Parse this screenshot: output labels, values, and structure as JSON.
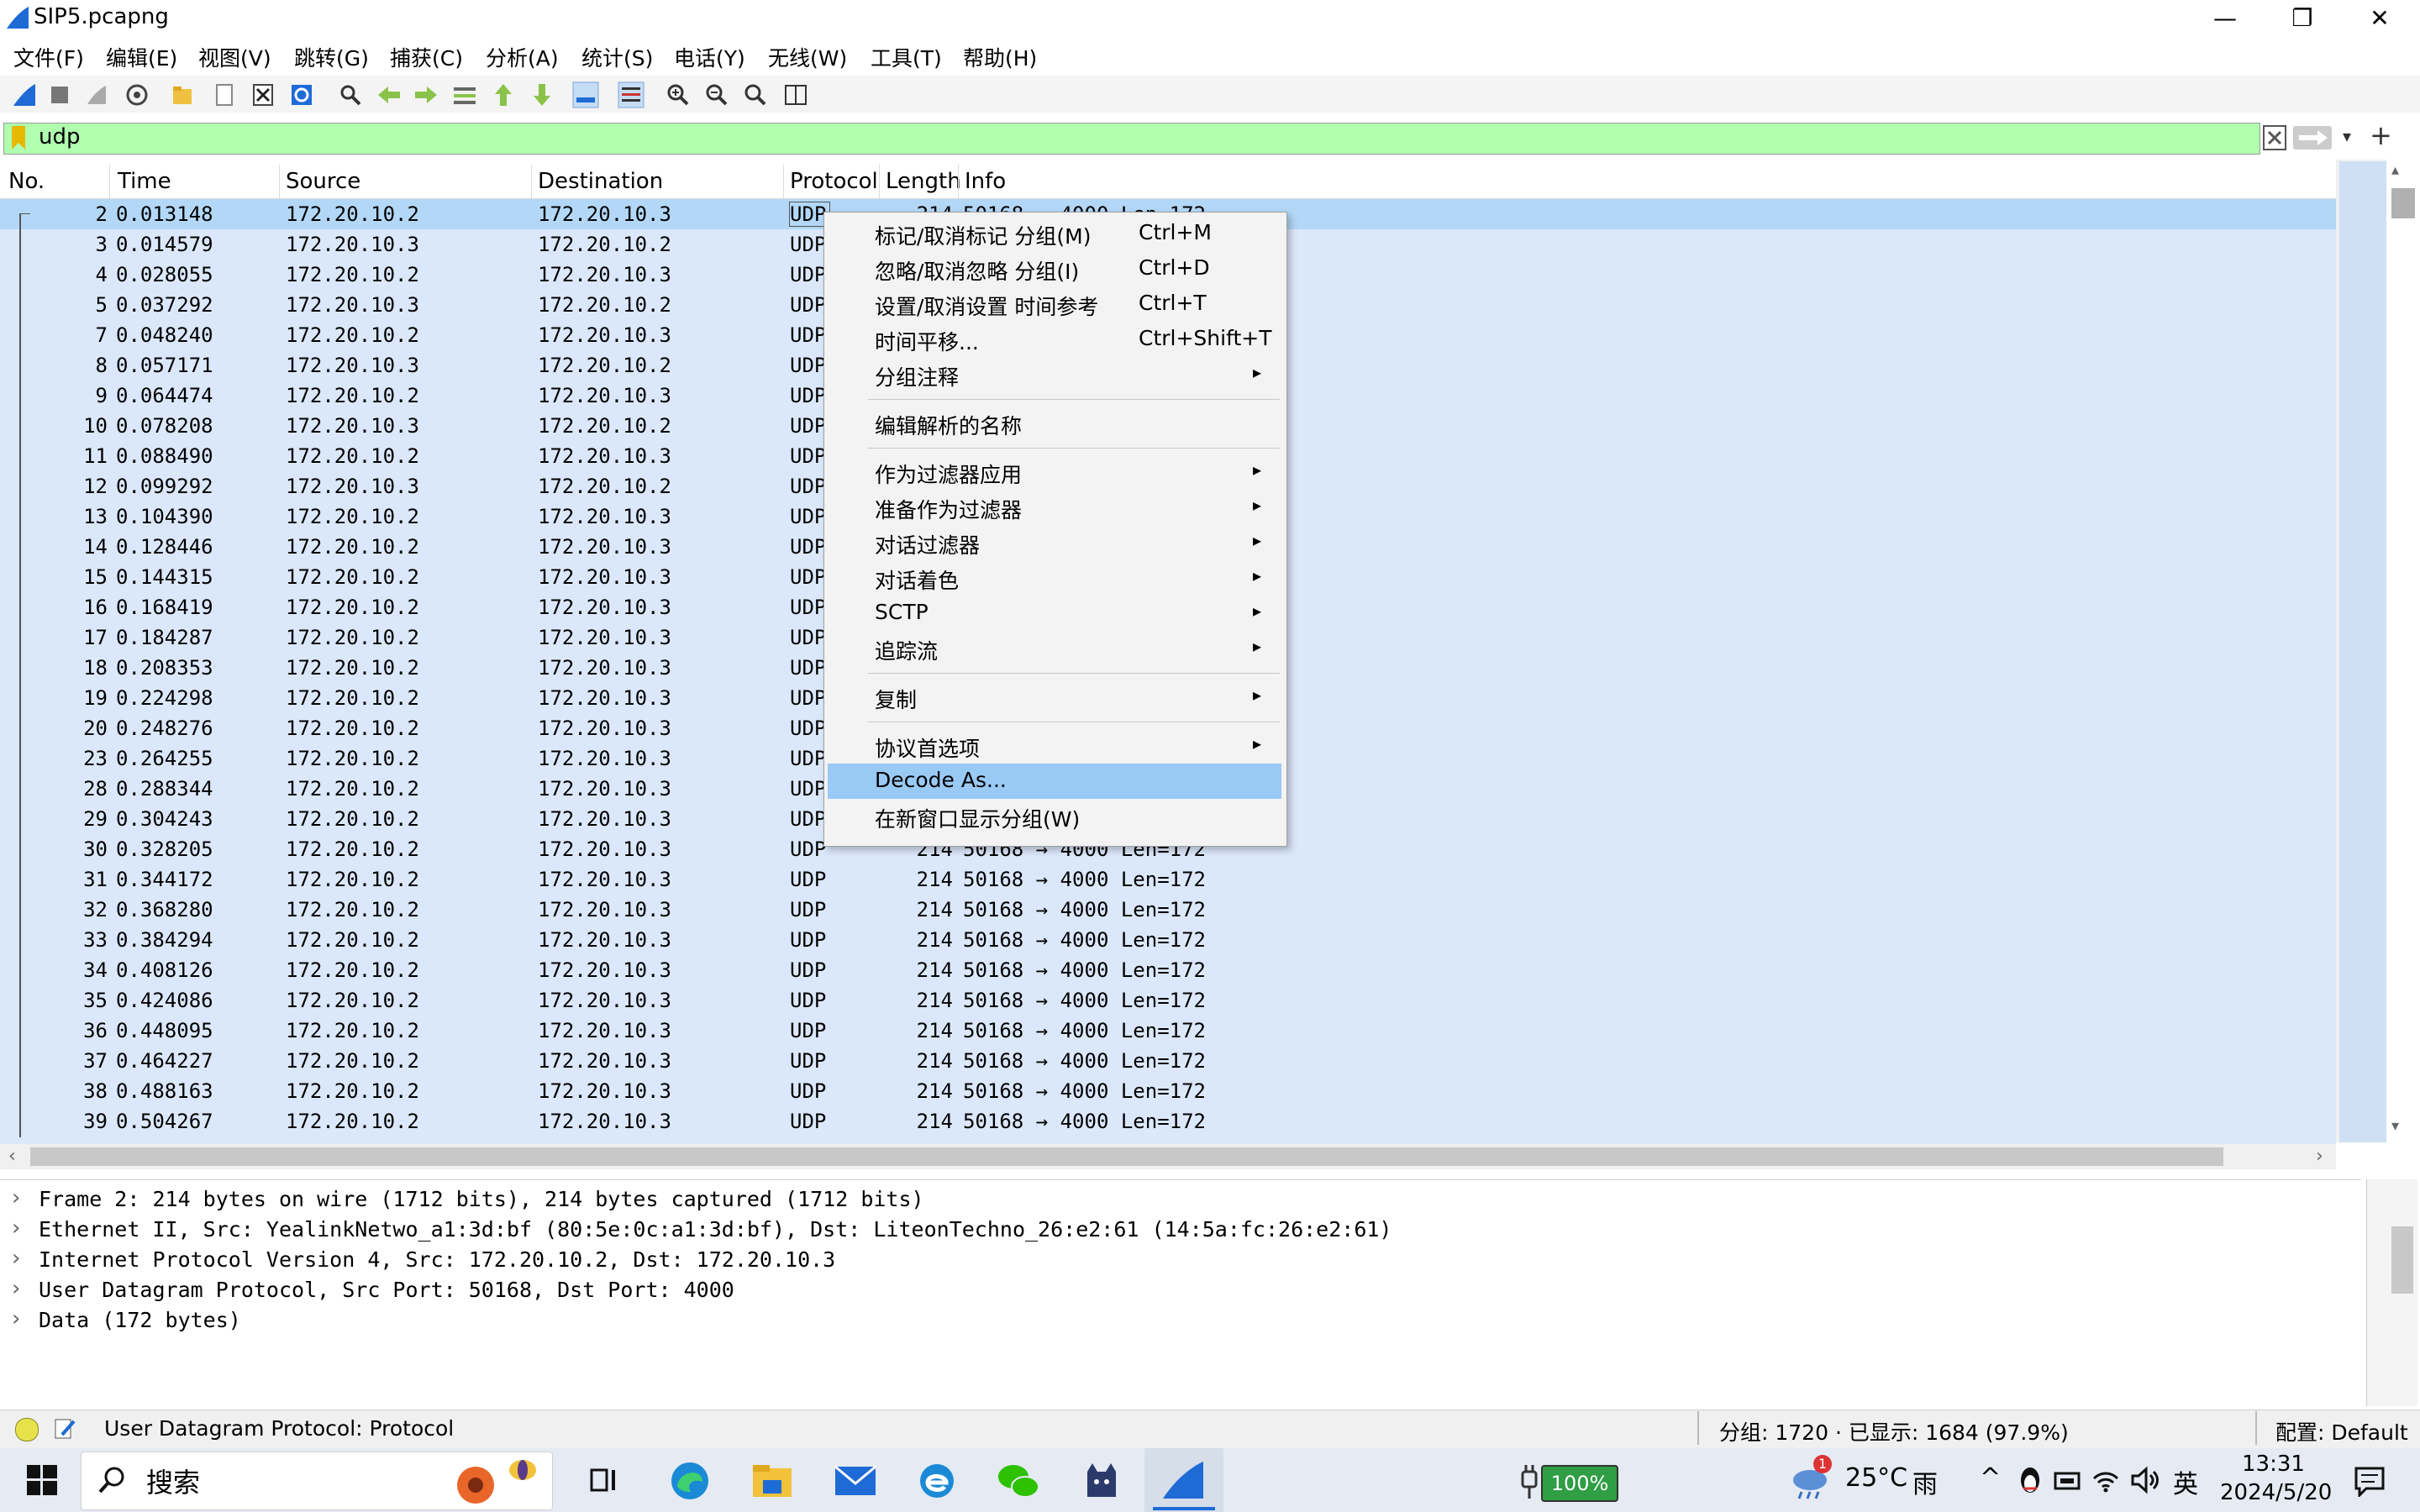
{
  "window": {
    "title": "SIP5.pcapng",
    "minimize": "—",
    "restore": "❐",
    "close": "✕"
  },
  "menubar": [
    "文件(F)",
    "编辑(E)",
    "视图(V)",
    "跳转(G)",
    "捕获(C)",
    "分析(A)",
    "统计(S)",
    "电话(Y)",
    "无线(W)",
    "工具(T)",
    "帮助(H)"
  ],
  "filter": {
    "value": "udp"
  },
  "columns": [
    "No.",
    "Time",
    "Source",
    "Destination",
    "Protocol",
    "Length",
    "Info"
  ],
  "packets": [
    {
      "no": "2",
      "time": "0.013148",
      "src": "172.20.10.2",
      "dst": "172.20.10.3",
      "proto": "UDP",
      "len": "214",
      "info": "50168 → 4000 Len=172"
    },
    {
      "no": "3",
      "time": "0.014579",
      "src": "172.20.10.3",
      "dst": "172.20.10.2",
      "proto": "UDP",
      "len": "",
      "info": ""
    },
    {
      "no": "4",
      "time": "0.028055",
      "src": "172.20.10.2",
      "dst": "172.20.10.3",
      "proto": "UDP",
      "len": "",
      "info": ""
    },
    {
      "no": "5",
      "time": "0.037292",
      "src": "172.20.10.3",
      "dst": "172.20.10.2",
      "proto": "UDP",
      "len": "",
      "info": ""
    },
    {
      "no": "7",
      "time": "0.048240",
      "src": "172.20.10.2",
      "dst": "172.20.10.3",
      "proto": "UDP",
      "len": "",
      "info": ""
    },
    {
      "no": "8",
      "time": "0.057171",
      "src": "172.20.10.3",
      "dst": "172.20.10.2",
      "proto": "UDP",
      "len": "",
      "info": ""
    },
    {
      "no": "9",
      "time": "0.064474",
      "src": "172.20.10.2",
      "dst": "172.20.10.3",
      "proto": "UDP",
      "len": "",
      "info": ""
    },
    {
      "no": "10",
      "time": "0.078208",
      "src": "172.20.10.3",
      "dst": "172.20.10.2",
      "proto": "UDP",
      "len": "",
      "info": ""
    },
    {
      "no": "11",
      "time": "0.088490",
      "src": "172.20.10.2",
      "dst": "172.20.10.3",
      "proto": "UDP",
      "len": "",
      "info": ""
    },
    {
      "no": "12",
      "time": "0.099292",
      "src": "172.20.10.3",
      "dst": "172.20.10.2",
      "proto": "UDP",
      "len": "",
      "info": ""
    },
    {
      "no": "13",
      "time": "0.104390",
      "src": "172.20.10.2",
      "dst": "172.20.10.3",
      "proto": "UDP",
      "len": "",
      "info": ""
    },
    {
      "no": "14",
      "time": "0.128446",
      "src": "172.20.10.2",
      "dst": "172.20.10.3",
      "proto": "UDP",
      "len": "",
      "info": ""
    },
    {
      "no": "15",
      "time": "0.144315",
      "src": "172.20.10.2",
      "dst": "172.20.10.3",
      "proto": "UDP",
      "len": "",
      "info": ""
    },
    {
      "no": "16",
      "time": "0.168419",
      "src": "172.20.10.2",
      "dst": "172.20.10.3",
      "proto": "UDP",
      "len": "",
      "info": ""
    },
    {
      "no": "17",
      "time": "0.184287",
      "src": "172.20.10.2",
      "dst": "172.20.10.3",
      "proto": "UDP",
      "len": "",
      "info": ""
    },
    {
      "no": "18",
      "time": "0.208353",
      "src": "172.20.10.2",
      "dst": "172.20.10.3",
      "proto": "UDP",
      "len": "",
      "info": ""
    },
    {
      "no": "19",
      "time": "0.224298",
      "src": "172.20.10.2",
      "dst": "172.20.10.3",
      "proto": "UDP",
      "len": "",
      "info": ""
    },
    {
      "no": "20",
      "time": "0.248276",
      "src": "172.20.10.2",
      "dst": "172.20.10.3",
      "proto": "UDP",
      "len": "",
      "info": ""
    },
    {
      "no": "23",
      "time": "0.264255",
      "src": "172.20.10.2",
      "dst": "172.20.10.3",
      "proto": "UDP",
      "len": "",
      "info": ""
    },
    {
      "no": "28",
      "time": "0.288344",
      "src": "172.20.10.2",
      "dst": "172.20.10.3",
      "proto": "UDP",
      "len": "",
      "info": ""
    },
    {
      "no": "29",
      "time": "0.304243",
      "src": "172.20.10.2",
      "dst": "172.20.10.3",
      "proto": "UDP",
      "len": "",
      "info": ""
    },
    {
      "no": "30",
      "time": "0.328205",
      "src": "172.20.10.2",
      "dst": "172.20.10.3",
      "proto": "UDP",
      "len": "214",
      "info": "50168 → 4000 Len=172"
    },
    {
      "no": "31",
      "time": "0.344172",
      "src": "172.20.10.2",
      "dst": "172.20.10.3",
      "proto": "UDP",
      "len": "214",
      "info": "50168 → 4000 Len=172"
    },
    {
      "no": "32",
      "time": "0.368280",
      "src": "172.20.10.2",
      "dst": "172.20.10.3",
      "proto": "UDP",
      "len": "214",
      "info": "50168 → 4000 Len=172"
    },
    {
      "no": "33",
      "time": "0.384294",
      "src": "172.20.10.2",
      "dst": "172.20.10.3",
      "proto": "UDP",
      "len": "214",
      "info": "50168 → 4000 Len=172"
    },
    {
      "no": "34",
      "time": "0.408126",
      "src": "172.20.10.2",
      "dst": "172.20.10.3",
      "proto": "UDP",
      "len": "214",
      "info": "50168 → 4000 Len=172"
    },
    {
      "no": "35",
      "time": "0.424086",
      "src": "172.20.10.2",
      "dst": "172.20.10.3",
      "proto": "UDP",
      "len": "214",
      "info": "50168 → 4000 Len=172"
    },
    {
      "no": "36",
      "time": "0.448095",
      "src": "172.20.10.2",
      "dst": "172.20.10.3",
      "proto": "UDP",
      "len": "214",
      "info": "50168 → 4000 Len=172"
    },
    {
      "no": "37",
      "time": "0.464227",
      "src": "172.20.10.2",
      "dst": "172.20.10.3",
      "proto": "UDP",
      "len": "214",
      "info": "50168 → 4000 Len=172"
    },
    {
      "no": "38",
      "time": "0.488163",
      "src": "172.20.10.2",
      "dst": "172.20.10.3",
      "proto": "UDP",
      "len": "214",
      "info": "50168 → 4000 Len=172"
    },
    {
      "no": "39",
      "time": "0.504267",
      "src": "172.20.10.2",
      "dst": "172.20.10.3",
      "proto": "UDP",
      "len": "214",
      "info": "50168 → 4000 Len=172"
    }
  ],
  "details": [
    "Frame 2: 214 bytes on wire (1712 bits), 214 bytes captured (1712 bits)",
    "Ethernet II, Src: YealinkNetwo_a1:3d:bf (80:5e:0c:a1:3d:bf), Dst: LiteonTechno_26:e2:61 (14:5a:fc:26:e2:61)",
    "Internet Protocol Version 4, Src: 172.20.10.2, Dst: 172.20.10.3",
    "User Datagram Protocol, Src Port: 50168, Dst Port: 4000",
    "Data (172 bytes)"
  ],
  "context_menu": {
    "items": [
      {
        "label": "标记/取消标记 分组(M)",
        "shortcut": "Ctrl+M",
        "sub": false
      },
      {
        "label": "忽略/取消忽略 分组(I)",
        "shortcut": "Ctrl+D",
        "sub": false
      },
      {
        "label": "设置/取消设置 时间参考",
        "shortcut": "Ctrl+T",
        "sub": false
      },
      {
        "label": "时间平移...",
        "shortcut": "Ctrl+Shift+T",
        "sub": false
      },
      {
        "label": "分组注释",
        "shortcut": "",
        "sub": true
      },
      {
        "sep": true
      },
      {
        "label": "编辑解析的名称",
        "shortcut": "",
        "sub": false
      },
      {
        "sep": true
      },
      {
        "label": "作为过滤器应用",
        "shortcut": "",
        "sub": true
      },
      {
        "label": "准备作为过滤器",
        "shortcut": "",
        "sub": true
      },
      {
        "label": "对话过滤器",
        "shortcut": "",
        "sub": true
      },
      {
        "label": "对话着色",
        "shortcut": "",
        "sub": true
      },
      {
        "label": "SCTP",
        "shortcut": "",
        "sub": true
      },
      {
        "label": "追踪流",
        "shortcut": "",
        "sub": true
      },
      {
        "sep": true
      },
      {
        "label": "复制",
        "shortcut": "",
        "sub": true
      },
      {
        "sep": true
      },
      {
        "label": "协议首选项",
        "shortcut": "",
        "sub": true
      },
      {
        "label": "Decode As...",
        "shortcut": "",
        "sub": false,
        "highlight": true
      },
      {
        "label": "在新窗口显示分组(W)",
        "shortcut": "",
        "sub": false
      }
    ]
  },
  "statusbar": {
    "protocol_text": "User Datagram Protocol: Protocol",
    "counts": "分组: 1720 · 已显示: 1684 (97.9%)",
    "profile": "配置: Default"
  },
  "taskbar": {
    "search": "搜索",
    "battery": "100%",
    "weather_temp": "25°C",
    "weather_text": "雨",
    "ime": "英",
    "time": "13:31",
    "date": "2024/5/20",
    "weather_badge": "1"
  },
  "colors": {
    "accent": "#1e6bd6",
    "filter_ok": "#afffaf",
    "row_bg": "#dbe8fb",
    "row_selected": "#b3d8f7",
    "menu_highlight": "#99c9f5"
  }
}
